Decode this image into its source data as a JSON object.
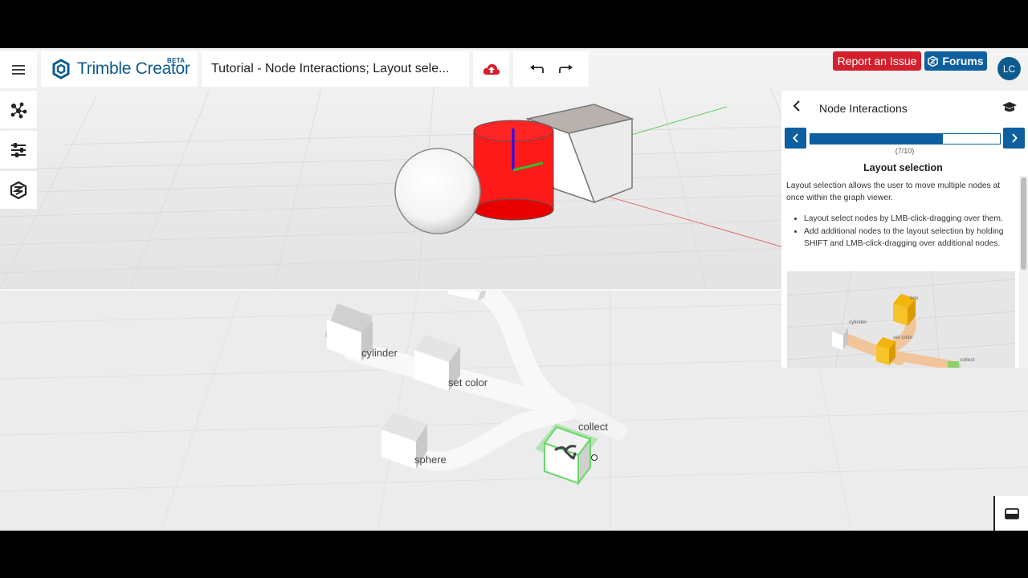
{
  "topbar": {
    "menu_icon": "hamburger-icon",
    "logo": {
      "name": "Trimble",
      "product": "Creator",
      "badge": "BETA"
    },
    "document_title": "Tutorial - Node Interactions; Layout sele...",
    "upload_icon": "cloud-upload-icon",
    "undo_icon": "undo-icon",
    "redo_icon": "redo-icon",
    "report_label": "Report an Issue",
    "forums_label": "Forums",
    "avatar_initials": "LC",
    "colors": {
      "report": "#d3202c",
      "forums": "#0d5fa0",
      "brand": "#0d5a8f"
    }
  },
  "left_toolbar": [
    {
      "icon": "node-graph-icon"
    },
    {
      "icon": "sliders-icon"
    },
    {
      "icon": "sketchup-icon"
    }
  ],
  "graph": {
    "nodes": [
      "cylinder",
      "set color",
      "sphere",
      "collect"
    ]
  },
  "tutorial": {
    "title": "Node Interactions",
    "progress": 0.7,
    "step_label": "(7/10)",
    "step_title": "Layout selection",
    "body": "Layout selection allows the user to move multiple nodes at once within the graph viewer.",
    "bullets": [
      "Layout select nodes by LMB-click-dragging over them.",
      "Add additional nodes to the layout selection by holding SHIFT and LMB-click-dragging over additional nodes."
    ],
    "image_labels": {
      "box": "box",
      "cylinder": "cylinder",
      "set_color": "set color",
      "collect": "collect"
    }
  }
}
